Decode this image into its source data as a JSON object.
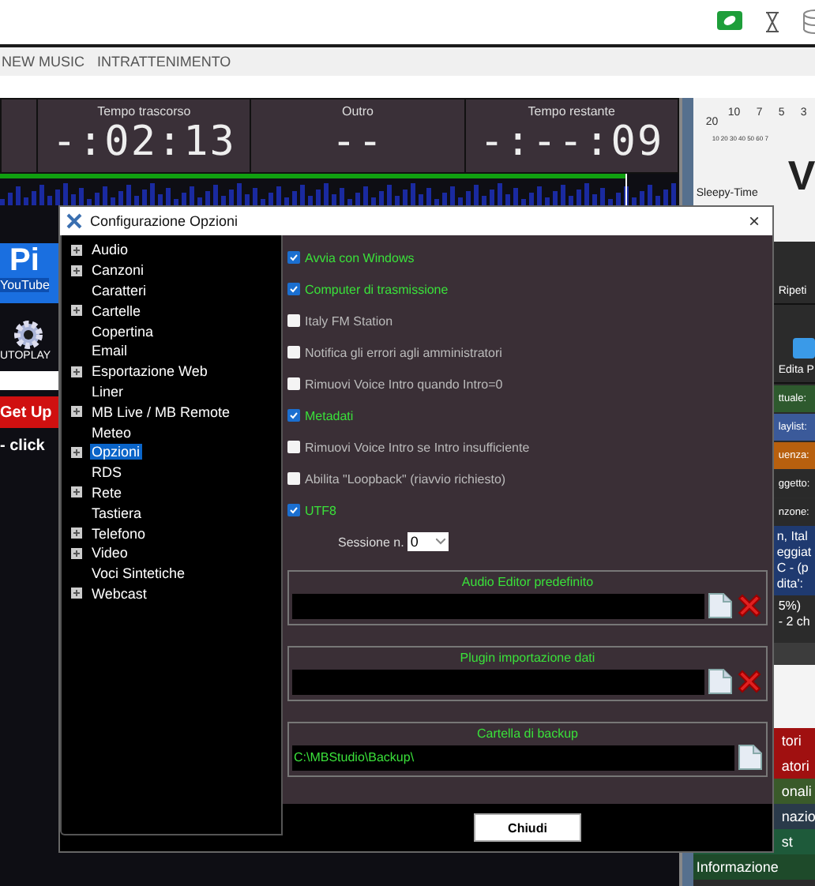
{
  "menu": {
    "items": [
      "NEW MUSIC",
      "INTRATTENIMENTO"
    ]
  },
  "timers": [
    {
      "label": "Tempo trascorso",
      "value": "-:02:13"
    },
    {
      "label": "Outro",
      "value": "--"
    },
    {
      "label": "Tempo restante",
      "value": "-:--:09"
    }
  ],
  "left_panel": {
    "banner_title": "Pi",
    "banner_sub": "YouTube",
    "autoplay": "UTOPLAY",
    "alert": "Get Up",
    "hint": "- click"
  },
  "right_panel": {
    "vu_scale": [
      "20",
      "10",
      "7",
      "5",
      "3"
    ],
    "vu_sub_scale": "10 20 30 40 50 60 7",
    "vu_big": "V",
    "track": "Sleepy-Time",
    "repeat": "Ripeti",
    "edit": "Edita P",
    "info_rows": [
      {
        "label": "ttuale:",
        "color": "#2e5a2e"
      },
      {
        "label": "laylist:",
        "color": "#3b5a9a"
      },
      {
        "label": "uenza:",
        "color": "#b8600e"
      },
      {
        "label": "ggetto:",
        "color": "#2a2a2a"
      },
      {
        "label": "nzone:",
        "color": "#2a2a2a"
      }
    ],
    "details": [
      "n, Ital",
      "eggiat",
      "C - (p",
      "dita':"
    ],
    "stats": [
      "5%)",
      "- 2 ch"
    ],
    "categories": [
      {
        "label": "tori",
        "color": "#a01010"
      },
      {
        "label": "atori",
        "color": "#a01010"
      },
      {
        "label": "onali",
        "color": "#3a5a2a"
      },
      {
        "label": "nazio",
        "color": "#2a3a4a"
      },
      {
        "label": "st",
        "color": "#1e5a3a"
      },
      {
        "label": "Informazione",
        "color": "#1e4a2a"
      }
    ]
  },
  "dialog": {
    "title": "Configurazione Opzioni",
    "close": "×",
    "tree": [
      {
        "label": "Audio",
        "kind": "group",
        "selected": false
      },
      {
        "label": "Canzoni",
        "kind": "group",
        "selected": false
      },
      {
        "label": "Caratteri",
        "kind": "leaf",
        "selected": false
      },
      {
        "label": "Cartelle",
        "kind": "group",
        "selected": false
      },
      {
        "label": "Copertina",
        "kind": "leaf",
        "selected": false
      },
      {
        "label": "Email",
        "kind": "leaf",
        "selected": false
      },
      {
        "label": "Esportazione Web",
        "kind": "group",
        "selected": false
      },
      {
        "label": "Liner",
        "kind": "leaf",
        "selected": false
      },
      {
        "label": "MB Live / MB Remote",
        "kind": "group",
        "selected": false
      },
      {
        "label": "Meteo",
        "kind": "leaf",
        "selected": false
      },
      {
        "label": "Opzioni",
        "kind": "group",
        "selected": true
      },
      {
        "label": "RDS",
        "kind": "leaf",
        "selected": false
      },
      {
        "label": "Rete",
        "kind": "group",
        "selected": false
      },
      {
        "label": "Tastiera",
        "kind": "leaf",
        "selected": false
      },
      {
        "label": "Telefono",
        "kind": "group",
        "selected": false
      },
      {
        "label": "Video",
        "kind": "group",
        "selected": false
      },
      {
        "label": "Voci Sintetiche",
        "kind": "leaf",
        "selected": false
      },
      {
        "label": "Webcast",
        "kind": "group",
        "selected": false
      }
    ],
    "options": [
      {
        "label": "Avvia con Windows",
        "checked": true
      },
      {
        "label": "Computer di trasmissione",
        "checked": true
      },
      {
        "label": "Italy FM Station",
        "checked": false
      },
      {
        "label": "Notifica gli errori agli amministratori",
        "checked": false
      },
      {
        "label": "Rimuovi Voice Intro quando Intro=0",
        "checked": false
      },
      {
        "label": "Metadati",
        "checked": true
      },
      {
        "label": "Rimuovi Voice Intro se Intro insufficiente",
        "checked": false
      },
      {
        "label": "Abilita \"Loopback\" (riavvio richiesto)",
        "checked": false
      },
      {
        "label": "UTF8",
        "checked": true
      }
    ],
    "session": {
      "label": "Sessione n.",
      "value": "0"
    },
    "paths": [
      {
        "title": "Audio Editor predefinito",
        "clearable": true
      },
      {
        "title": "Plugin importazione dati",
        "clearable": true
      },
      {
        "title": "Cartella di backup",
        "value": "C:\\MBStudio\\Backup\\",
        "clearable": false
      }
    ],
    "close_button": "Chiudi"
  }
}
